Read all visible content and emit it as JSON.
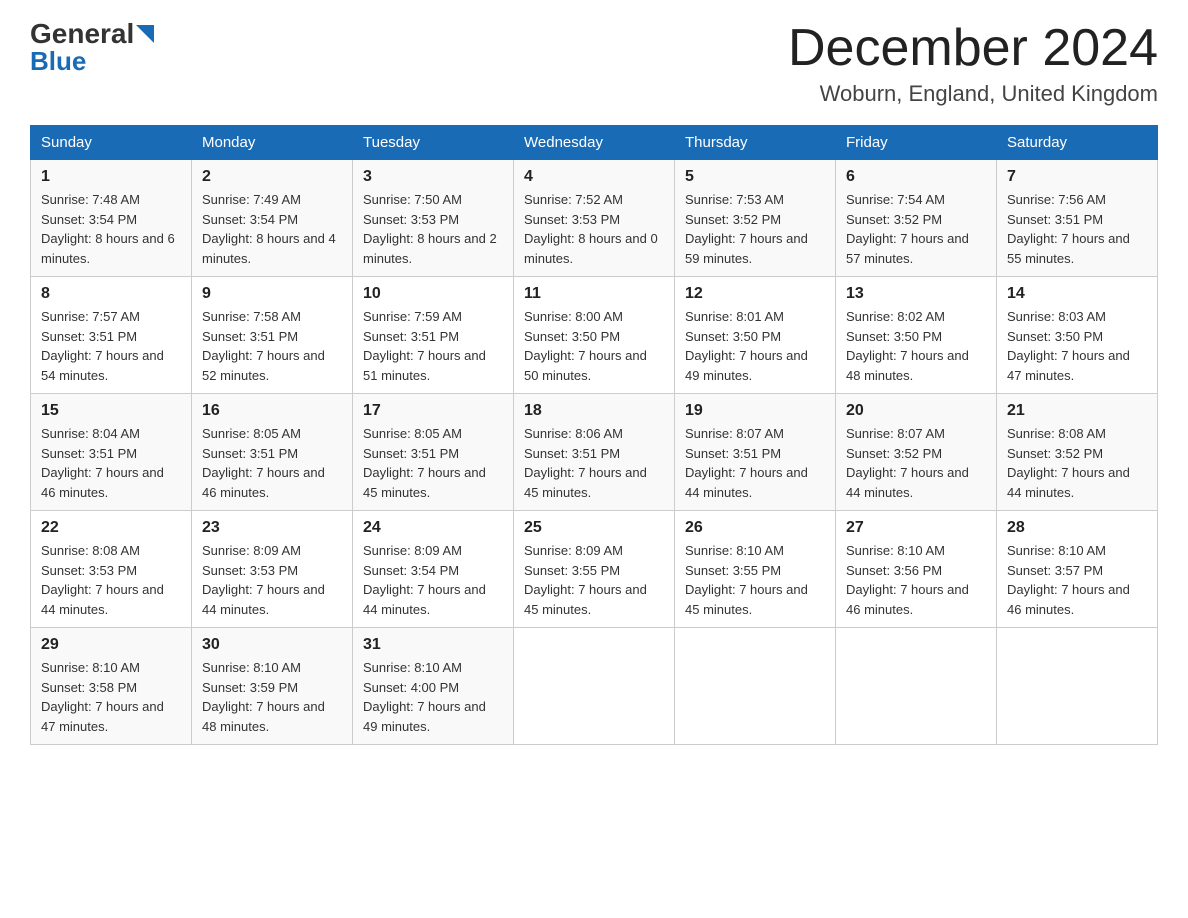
{
  "header": {
    "title": "December 2024",
    "subtitle": "Woburn, England, United Kingdom",
    "logo_general": "General",
    "logo_blue": "Blue"
  },
  "days_of_week": [
    "Sunday",
    "Monday",
    "Tuesday",
    "Wednesday",
    "Thursday",
    "Friday",
    "Saturday"
  ],
  "weeks": [
    [
      {
        "day": "1",
        "sunrise": "7:48 AM",
        "sunset": "3:54 PM",
        "daylight": "8 hours and 6 minutes."
      },
      {
        "day": "2",
        "sunrise": "7:49 AM",
        "sunset": "3:54 PM",
        "daylight": "8 hours and 4 minutes."
      },
      {
        "day": "3",
        "sunrise": "7:50 AM",
        "sunset": "3:53 PM",
        "daylight": "8 hours and 2 minutes."
      },
      {
        "day": "4",
        "sunrise": "7:52 AM",
        "sunset": "3:53 PM",
        "daylight": "8 hours and 0 minutes."
      },
      {
        "day": "5",
        "sunrise": "7:53 AM",
        "sunset": "3:52 PM",
        "daylight": "7 hours and 59 minutes."
      },
      {
        "day": "6",
        "sunrise": "7:54 AM",
        "sunset": "3:52 PM",
        "daylight": "7 hours and 57 minutes."
      },
      {
        "day": "7",
        "sunrise": "7:56 AM",
        "sunset": "3:51 PM",
        "daylight": "7 hours and 55 minutes."
      }
    ],
    [
      {
        "day": "8",
        "sunrise": "7:57 AM",
        "sunset": "3:51 PM",
        "daylight": "7 hours and 54 minutes."
      },
      {
        "day": "9",
        "sunrise": "7:58 AM",
        "sunset": "3:51 PM",
        "daylight": "7 hours and 52 minutes."
      },
      {
        "day": "10",
        "sunrise": "7:59 AM",
        "sunset": "3:51 PM",
        "daylight": "7 hours and 51 minutes."
      },
      {
        "day": "11",
        "sunrise": "8:00 AM",
        "sunset": "3:50 PM",
        "daylight": "7 hours and 50 minutes."
      },
      {
        "day": "12",
        "sunrise": "8:01 AM",
        "sunset": "3:50 PM",
        "daylight": "7 hours and 49 minutes."
      },
      {
        "day": "13",
        "sunrise": "8:02 AM",
        "sunset": "3:50 PM",
        "daylight": "7 hours and 48 minutes."
      },
      {
        "day": "14",
        "sunrise": "8:03 AM",
        "sunset": "3:50 PM",
        "daylight": "7 hours and 47 minutes."
      }
    ],
    [
      {
        "day": "15",
        "sunrise": "8:04 AM",
        "sunset": "3:51 PM",
        "daylight": "7 hours and 46 minutes."
      },
      {
        "day": "16",
        "sunrise": "8:05 AM",
        "sunset": "3:51 PM",
        "daylight": "7 hours and 46 minutes."
      },
      {
        "day": "17",
        "sunrise": "8:05 AM",
        "sunset": "3:51 PM",
        "daylight": "7 hours and 45 minutes."
      },
      {
        "day": "18",
        "sunrise": "8:06 AM",
        "sunset": "3:51 PM",
        "daylight": "7 hours and 45 minutes."
      },
      {
        "day": "19",
        "sunrise": "8:07 AM",
        "sunset": "3:51 PM",
        "daylight": "7 hours and 44 minutes."
      },
      {
        "day": "20",
        "sunrise": "8:07 AM",
        "sunset": "3:52 PM",
        "daylight": "7 hours and 44 minutes."
      },
      {
        "day": "21",
        "sunrise": "8:08 AM",
        "sunset": "3:52 PM",
        "daylight": "7 hours and 44 minutes."
      }
    ],
    [
      {
        "day": "22",
        "sunrise": "8:08 AM",
        "sunset": "3:53 PM",
        "daylight": "7 hours and 44 minutes."
      },
      {
        "day": "23",
        "sunrise": "8:09 AM",
        "sunset": "3:53 PM",
        "daylight": "7 hours and 44 minutes."
      },
      {
        "day": "24",
        "sunrise": "8:09 AM",
        "sunset": "3:54 PM",
        "daylight": "7 hours and 44 minutes."
      },
      {
        "day": "25",
        "sunrise": "8:09 AM",
        "sunset": "3:55 PM",
        "daylight": "7 hours and 45 minutes."
      },
      {
        "day": "26",
        "sunrise": "8:10 AM",
        "sunset": "3:55 PM",
        "daylight": "7 hours and 45 minutes."
      },
      {
        "day": "27",
        "sunrise": "8:10 AM",
        "sunset": "3:56 PM",
        "daylight": "7 hours and 46 minutes."
      },
      {
        "day": "28",
        "sunrise": "8:10 AM",
        "sunset": "3:57 PM",
        "daylight": "7 hours and 46 minutes."
      }
    ],
    [
      {
        "day": "29",
        "sunrise": "8:10 AM",
        "sunset": "3:58 PM",
        "daylight": "7 hours and 47 minutes."
      },
      {
        "day": "30",
        "sunrise": "8:10 AM",
        "sunset": "3:59 PM",
        "daylight": "7 hours and 48 minutes."
      },
      {
        "day": "31",
        "sunrise": "8:10 AM",
        "sunset": "4:00 PM",
        "daylight": "7 hours and 49 minutes."
      },
      null,
      null,
      null,
      null
    ]
  ],
  "labels": {
    "sunrise_prefix": "Sunrise: ",
    "sunset_prefix": "Sunset: ",
    "daylight_prefix": "Daylight: "
  }
}
